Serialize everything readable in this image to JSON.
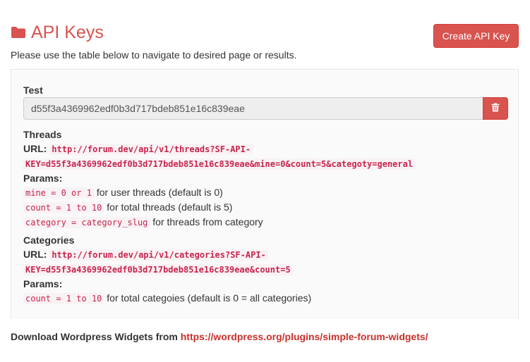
{
  "header": {
    "title": "API Keys",
    "create_button": "Create API Key",
    "subtitle": "Please use the table below to navigate to desired page or results.",
    "icon": "folder-icon"
  },
  "key": {
    "label": "Test",
    "value": "d55f3a4369962edf0b3d717bdeb851e16c839eae",
    "delete_icon": "trash-icon"
  },
  "threads": {
    "title": "Threads",
    "url_label": "URL:",
    "url_line1": "http://forum.dev/api/v1/threads?SF-API-",
    "url_line2": "KEY=d55f3a4369962edf0b3d717bdeb851e16c839eae&mine=0&count=5&categoty=general",
    "params_label": "Params:",
    "params": [
      {
        "code": "mine = 0 or 1",
        "desc": "for user threads (default is 0)"
      },
      {
        "code": "count = 1 to 10",
        "desc": "for total threads (default is 5)"
      },
      {
        "code": "category = category_slug",
        "desc": "for threads from category"
      }
    ]
  },
  "categories": {
    "title": "Categories",
    "url_label": "URL:",
    "url_line1": "http://forum.dev/api/v1/categories?SF-API-",
    "url_line2": "KEY=d55f3a4369962edf0b3d717bdeb851e16c839eae&count=5",
    "params_label": "Params:",
    "params": [
      {
        "code": "count = 1 to 10",
        "desc": "for total categoies (default is 0 = all categories)"
      }
    ]
  },
  "footer": {
    "text": "Download Wordpress Widgets from",
    "link": "https://wordpress.org/plugins/simple-forum-widgets/"
  },
  "colors": {
    "accent": "#d9534f",
    "code_text": "#c7254e",
    "code_bg": "#f9f2f4"
  }
}
